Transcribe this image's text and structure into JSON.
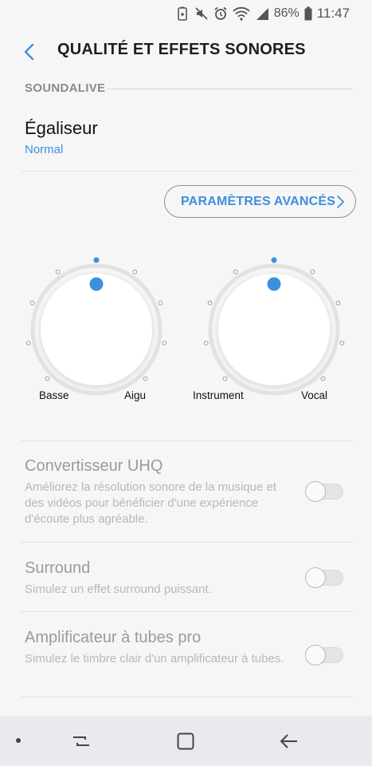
{
  "status_bar": {
    "battery_percent": "86%",
    "time": "11:47"
  },
  "header": {
    "title": "QUALITÉ ET EFFETS SONORES"
  },
  "section": {
    "label": "SOUNDALIVE"
  },
  "equalizer": {
    "title": "Égaliseur",
    "value": "Normal"
  },
  "advanced_button": {
    "label": "PARAMÈTRES AVANCÉS"
  },
  "knobs": [
    {
      "left_label": "Basse",
      "right_label": "Aigu",
      "level": 0.5
    },
    {
      "left_label": "Instrument",
      "right_label": "Vocal",
      "level": 0.5
    }
  ],
  "settings": [
    {
      "title": "Convertisseur UHQ",
      "description": "Améliorez la résolution sonore de la musique et des vidéos pour bénéficier d'une expérience d'écoute plus agréable.",
      "enabled": false
    },
    {
      "title": "Surround",
      "description": "Simulez un effet surround puissant.",
      "enabled": false
    },
    {
      "title": "Amplificateur à tubes pro",
      "description": "Simulez le timbre clair d'un amplificateur à tubes.",
      "enabled": false
    }
  ],
  "colors": {
    "accent": "#3d8fe0",
    "background": "#f6f6f6",
    "disabled_text": "#9b9b9b"
  }
}
